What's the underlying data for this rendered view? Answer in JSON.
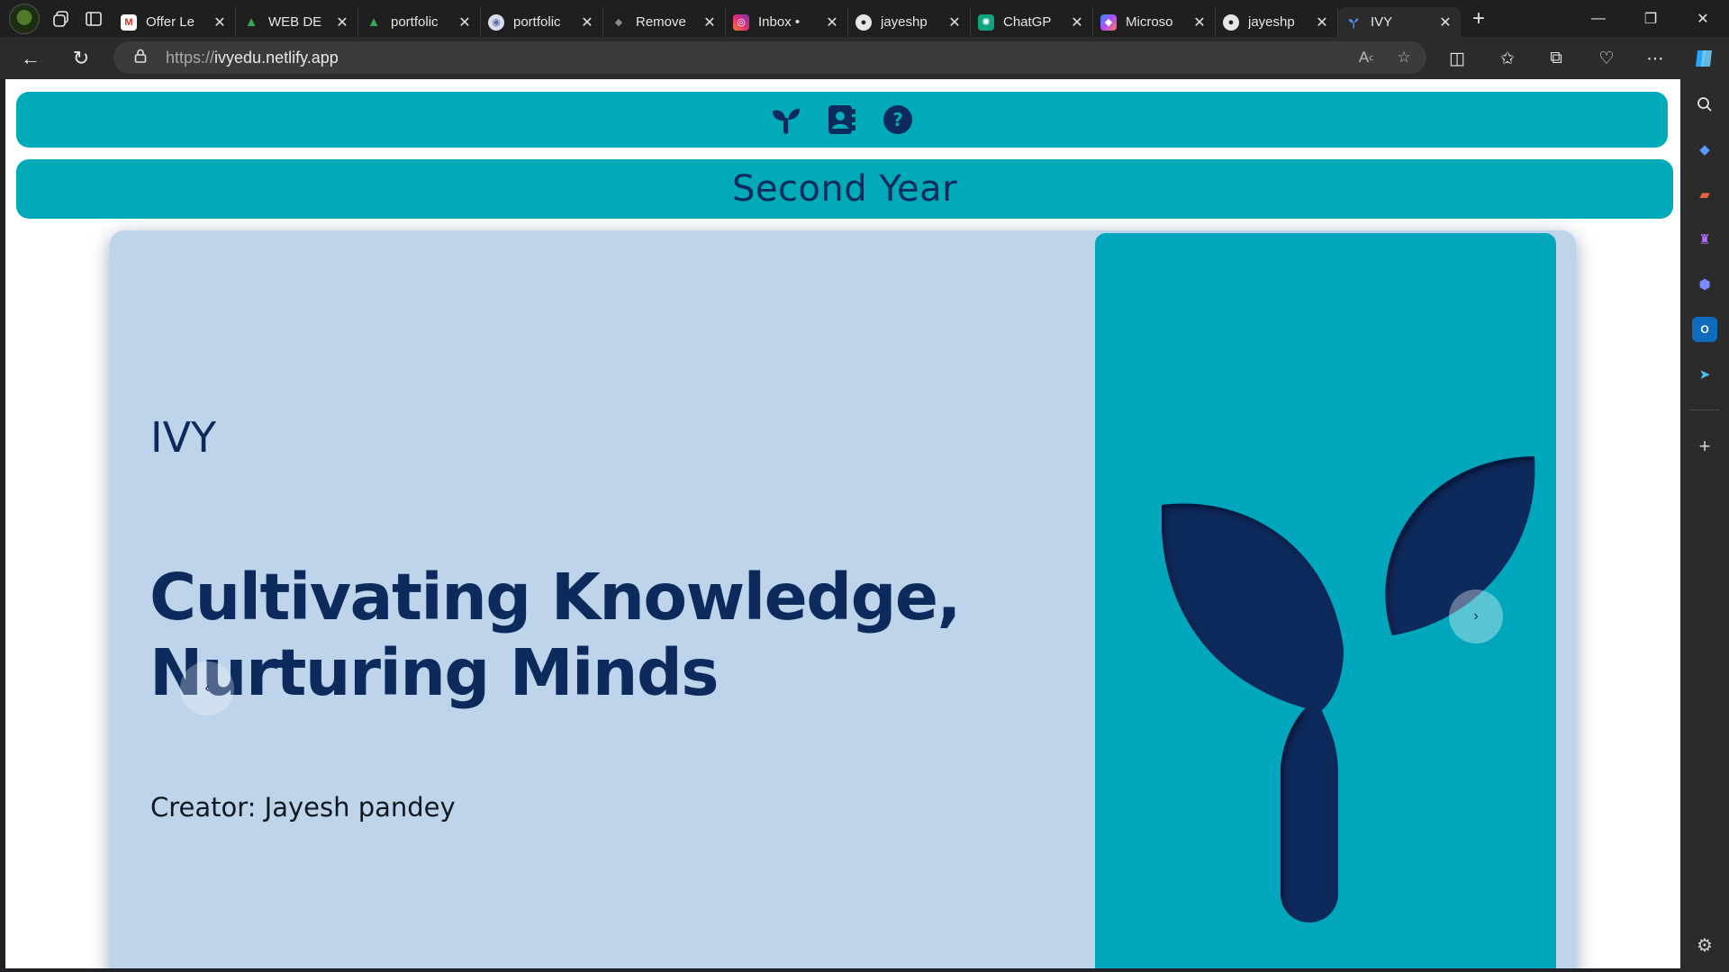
{
  "browser": {
    "tabs": [
      {
        "label": "Offer Le",
        "favicon": "gmail-icon",
        "color": "#d93025",
        "glyph": "M"
      },
      {
        "label": "WEB DE",
        "favicon": "drive-icon",
        "color": "#188038",
        "glyph": "▲"
      },
      {
        "label": "portfolic",
        "favicon": "drive-icon",
        "color": "#188038",
        "glyph": "▲"
      },
      {
        "label": "portfolic",
        "favicon": "globe-icon",
        "color": "#5f6ea0",
        "glyph": "◉"
      },
      {
        "label": "Remove",
        "favicon": "layers-icon",
        "color": "#6b6b6b",
        "glyph": "◆"
      },
      {
        "label": "Inbox • ",
        "favicon": "instagram-icon",
        "color": "#c13584",
        "glyph": "◎"
      },
      {
        "label": "jayeshp",
        "favicon": "github-icon",
        "color": "#333333",
        "glyph": "●"
      },
      {
        "label": "ChatGP",
        "favicon": "chatgpt-icon",
        "color": "#10a37f",
        "glyph": "✺"
      },
      {
        "label": "Microso",
        "favicon": "copilot-icon",
        "color": "#7b5cff",
        "glyph": "◆"
      },
      {
        "label": "jayeshp",
        "favicon": "github-icon",
        "color": "#333333",
        "glyph": "●"
      },
      {
        "label": "IVY",
        "favicon": "sprout-icon",
        "color": "#2b2b2b",
        "glyph": "Y",
        "active": true
      }
    ],
    "url_scheme": "https://",
    "url_host": "ivyedu.netlify.app"
  },
  "site": {
    "nav_icons": [
      "sprout-icon",
      "contact-book-icon",
      "help-circle-icon"
    ],
    "year_title": "Second Year",
    "brand_name": "IVY",
    "headline_line1": "Cultivating Knowledge,",
    "headline_line2": "Nurturing Minds",
    "creator": "Creator: Jayesh pandey",
    "prev_label": "‹",
    "next_label": "›"
  },
  "colors": {
    "accent_teal": "#00aab9",
    "navy": "#0c2a5c",
    "card_bg": "#bed4ea"
  }
}
